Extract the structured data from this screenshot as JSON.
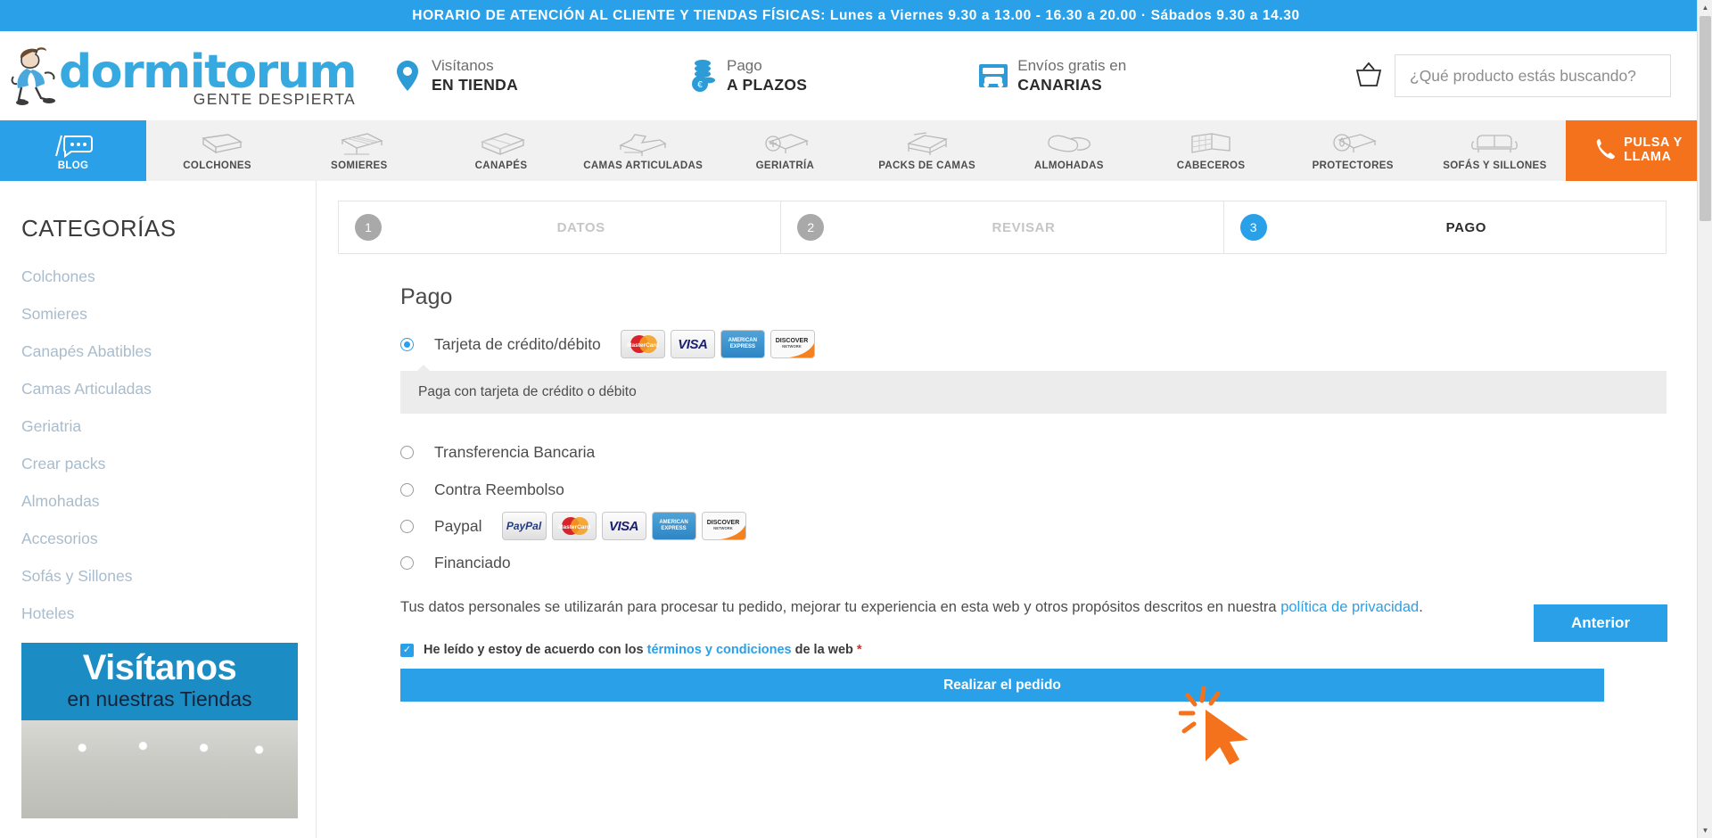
{
  "promo": {
    "text": "HORARIO DE ATENCIÓN AL CLIENTE Y TIENDAS FÍSICAS: Lunes a Viernes 9.30 a 13.00 - 16.30 a 20.00 · Sábados 9.30 a 14.30",
    "bg": "#2aa0e8"
  },
  "header": {
    "logo_word": "dormitorum",
    "logo_tagline": "GENTE DESPIERTA",
    "logo_color": "#36a9e1",
    "badges": [
      {
        "icon": "location-pin-icon",
        "line1": "Visítanos",
        "line2": "EN TIENDA"
      },
      {
        "icon": "coins-icon",
        "line1": "Pago",
        "line2": "A PLAZOS"
      },
      {
        "icon": "truck-icon",
        "line1": "Envíos gratis en",
        "line2": "CANARIAS"
      }
    ],
    "cart_icon": "basket-icon",
    "search": {
      "placeholder": "¿Qué producto estás buscando?",
      "value": ""
    }
  },
  "nav": {
    "active_accent": "#2aa0e8",
    "call_accent": "#f4721c",
    "items": [
      {
        "label": "BLOG",
        "icon": "blog-chat-icon",
        "active": true
      },
      {
        "label": "COLCHONES",
        "icon": "mattress-icon",
        "active": false
      },
      {
        "label": "SOMIERES",
        "icon": "bed-base-icon",
        "active": false
      },
      {
        "label": "CANAPÉS",
        "icon": "canape-icon",
        "active": false
      },
      {
        "label": "CAMAS ARTICULADAS",
        "icon": "articulated-bed-icon",
        "active": false
      },
      {
        "label": "GERIATRÍA",
        "icon": "geriatric-icon",
        "active": false
      },
      {
        "label": "PACKS DE CAMAS",
        "icon": "bed-pack-icon",
        "active": false
      },
      {
        "label": "ALMOHADAS",
        "icon": "pillow-icon",
        "active": false
      },
      {
        "label": "CABECEROS",
        "icon": "headboard-icon",
        "active": false
      },
      {
        "label": "PROTECTORES",
        "icon": "protector-icon",
        "active": false
      },
      {
        "label": "SOFÁS Y SILLONES",
        "icon": "sofa-icon",
        "active": false
      }
    ],
    "call": {
      "line1": "PULSA Y",
      "line2": "LLAMA",
      "icon": "phone-icon"
    }
  },
  "sidebar": {
    "title": "CATEGORÍAS",
    "items": [
      {
        "label": "Colchones"
      },
      {
        "label": "Somieres"
      },
      {
        "label": "Canapés Abatibles"
      },
      {
        "label": "Camas Articuladas"
      },
      {
        "label": "Geriatria"
      },
      {
        "label": "Crear packs"
      },
      {
        "label": "Almohadas"
      },
      {
        "label": "Accesorios"
      },
      {
        "label": "Sofás y Sillones"
      },
      {
        "label": "Hoteles"
      }
    ],
    "banner": {
      "line1": "Visítanos",
      "line2": "en nuestras Tiendas"
    }
  },
  "checkout": {
    "steps": [
      {
        "num": "1",
        "label": "DATOS",
        "active": false
      },
      {
        "num": "2",
        "label": "REVISAR",
        "active": false
      },
      {
        "num": "3",
        "label": "PAGO",
        "active": true
      }
    ],
    "section_title": "Pago",
    "methods": [
      {
        "label": "Tarjeta de crédito/débito",
        "selected": true,
        "cards": [
          "mastercard",
          "visa",
          "amex",
          "discover"
        ]
      },
      {
        "label": "Transferencia Bancaria",
        "selected": false,
        "cards": []
      },
      {
        "label": "Contra Reembolso",
        "selected": false,
        "cards": []
      },
      {
        "label": "Paypal",
        "selected": false,
        "cards": [
          "paypal",
          "mastercard",
          "visa",
          "amex",
          "discover"
        ]
      },
      {
        "label": "Financiado",
        "selected": false,
        "cards": []
      }
    ],
    "method_info": "Paga con tarjeta de crédito o débito",
    "privacy_text": "Tus datos personales se utilizarán para procesar tu pedido, mejorar tu experiencia en esta web y otros propósitos descritos en nuestra ",
    "privacy_link": "política de privacidad",
    "privacy_end": ".",
    "terms_pre": "He leído y estoy de acuerdo con los ",
    "terms_link": "términos y condiciones",
    "terms_post": " de la web ",
    "terms_required": "*",
    "terms_checked": true,
    "place_order_label": "Realizar el pedido",
    "previous_label": "Anterior"
  },
  "card_labels": {
    "mastercard": "MasterCard",
    "visa": "VISA",
    "amex_l1": "AMERICAN",
    "amex_l2": "EXPRESS",
    "discover_l1": "DISCOVER",
    "discover_l2": "NETWORK",
    "paypal": "PayPal"
  },
  "cursor": {
    "icon": "click-cursor-icon",
    "color": "#f4721c"
  },
  "scrollbar": {
    "up": "▲",
    "down": "▼"
  }
}
